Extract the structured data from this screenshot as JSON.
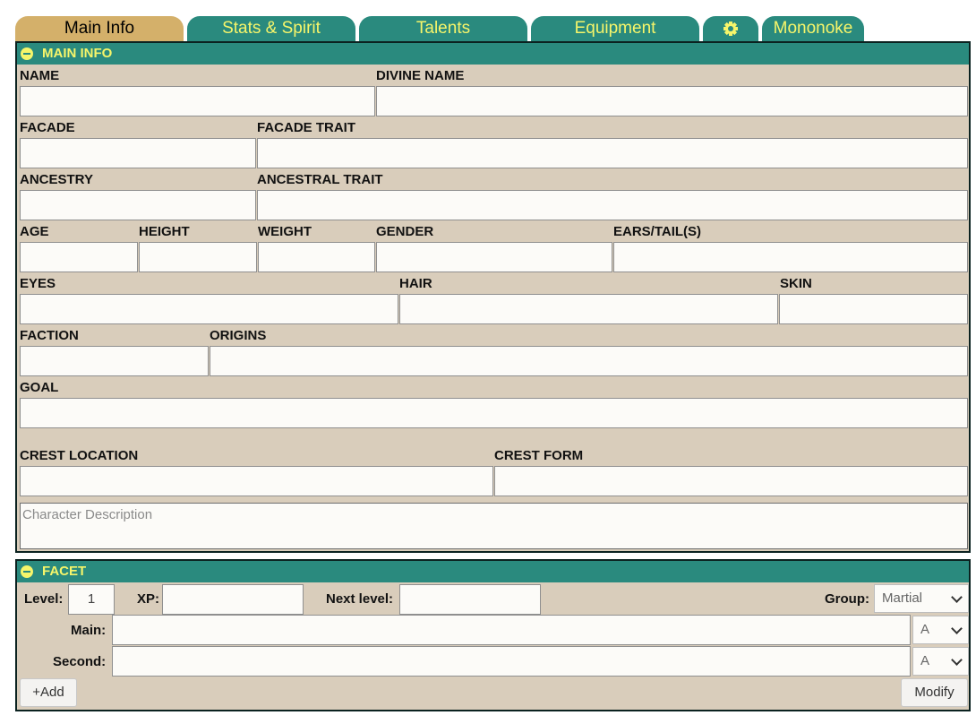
{
  "tabs": {
    "main_info": "Main Info",
    "stats_spirit": "Stats & Spirit",
    "talents": "Talents",
    "equipment": "Equipment",
    "settings_icon": "gear-icon",
    "mononoke": "Mononoke"
  },
  "main_info": {
    "title": "MAIN INFO",
    "labels": {
      "name": "NAME",
      "divine_name": "DIVINE NAME",
      "facade": "FACADE",
      "facade_trait": "FACADE TRAIT",
      "ancestry": "ANCESTRY",
      "ancestral_trait": "ANCESTRAL TRAIT",
      "age": "AGE",
      "height": "HEIGHT",
      "weight": "WEIGHT",
      "gender": "GENDER",
      "ears_tails": "EARS/TAIL(S)",
      "eyes": "EYES",
      "hair": "HAIR",
      "skin": "SKIN",
      "faction": "FACTION",
      "origins": "ORIGINS",
      "goal": "GOAL",
      "crest_location": "CREST LOCATION",
      "crest_form": "CREST FORM"
    },
    "description_placeholder": "Character Description"
  },
  "facet": {
    "title": "FACET",
    "level_label": "Level:",
    "level_value": "1",
    "xp_label": "XP:",
    "next_level_label": "Next level:",
    "group_label": "Group:",
    "group_value": "Martial",
    "main_label": "Main:",
    "main_grade": "A",
    "second_label": "Second:",
    "second_grade": "A",
    "add_button": "+Add",
    "modify_button": "Modify"
  },
  "colors": {
    "tab_active": "#d4b06a",
    "tab_green": "#2a8a7e",
    "tab_text": "#f6f56a",
    "panel_bg": "#d9cdbb"
  }
}
